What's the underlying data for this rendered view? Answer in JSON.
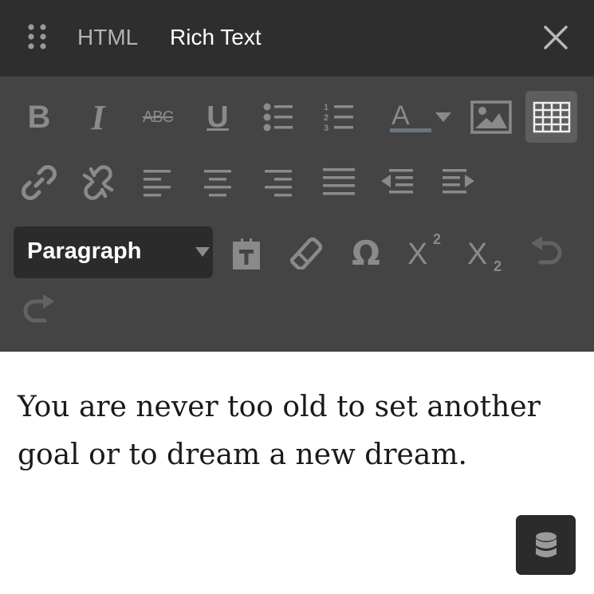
{
  "header": {
    "tabs": [
      {
        "label": "HTML",
        "active": false
      },
      {
        "label": "Rich Text",
        "active": true
      }
    ]
  },
  "toolbar": {
    "icons": {
      "bold": "bold-icon",
      "italic": "italic-icon",
      "strikethrough": "strikethrough-icon",
      "underline": "underline-icon",
      "bullet_list": "bullet-list-icon",
      "numbered_list": "numbered-list-icon",
      "text_color": "text-color-icon",
      "image": "image-icon",
      "table": "table-icon",
      "link": "link-icon",
      "unlink": "unlink-icon",
      "align_left": "align-left-icon",
      "align_center": "align-center-icon",
      "align_right": "align-right-icon",
      "justify": "justify-icon",
      "outdent": "outdent-icon",
      "indent": "indent-icon",
      "paste_text": "paste-text-icon",
      "clear_format": "eraser-icon",
      "special_char": "omega-icon",
      "superscript": "superscript-icon",
      "subscript": "subscript-icon",
      "undo": "undo-icon",
      "redo": "redo-icon"
    },
    "bold_glyph": "B",
    "italic_glyph": "I",
    "strike_glyph": "ABC",
    "underline_glyph": "U",
    "color_glyph": "A",
    "special_char_glyph": "Ω",
    "superscript_glyph": "X",
    "superscript_exp": "2",
    "subscript_glyph": "X",
    "subscript_exp": "2",
    "format_select": {
      "value": "Paragraph"
    }
  },
  "content": {
    "text": "You are never too old to set another goal or to dream a new dream."
  },
  "colors": {
    "titlebar": "#2e2e2e",
    "toolbar": "#444444",
    "icon": "#8a8a8a",
    "active_tab": "#ffffff",
    "inactive_tab": "#b3b3b3"
  }
}
